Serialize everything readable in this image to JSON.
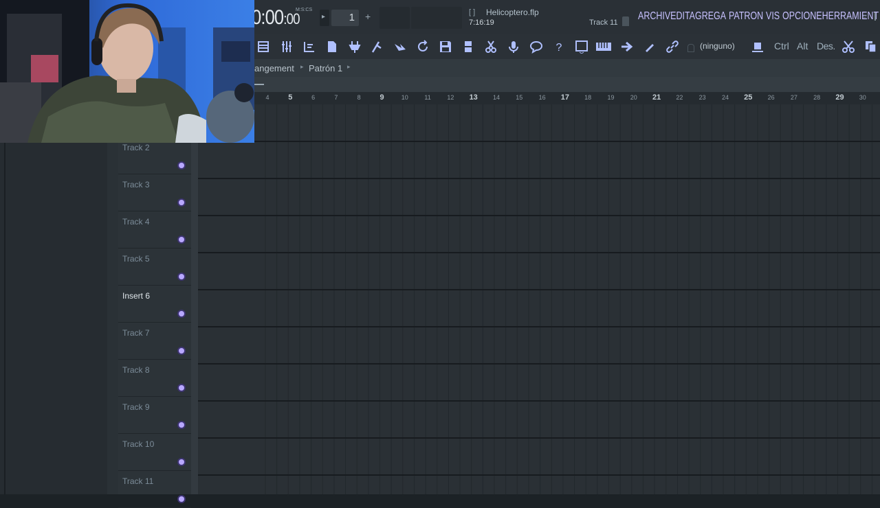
{
  "transport": {
    "time": "0:00",
    "time_small": ":00",
    "time_mode": "M:S:CS",
    "pattern_number": "1",
    "plus": "+",
    "play": "▸"
  },
  "project": {
    "bracket": "[ ]",
    "filename": "Helicoptero.flp",
    "elapsed": "7:16:19",
    "hint_track": "Track 11"
  },
  "menu": {
    "items": [
      "ARCHIV",
      "EDITA",
      "GREGA",
      "PATRON",
      "VIS",
      "OPCIONE",
      "HERRAMIENT",
      "A"
    ]
  },
  "window_controls": {
    "minimize": "–",
    "maximize": "▫"
  },
  "toolbar": {
    "icons": [
      "playlist-icon",
      "mixer-icon",
      "channel-rack-icon",
      "piano-roll-icon",
      "plugin-icon",
      "browser-icon",
      "arrow-icon",
      "refresh-icon",
      "save-icon",
      "render-icon",
      "cut-icon",
      "mic-icon",
      "comment-icon",
      "help-icon",
      "view-icon",
      "keyboard-icon",
      "next-icon",
      "pen-icon",
      "link-icon"
    ],
    "none_label": "(ninguno)",
    "ctrl_label": "Ctrl",
    "alt_label": "Alt",
    "des_label": "Des."
  },
  "breadcrumb": {
    "part1": "angement",
    "sep": "▸",
    "part2": "Patrón 1",
    "sep2": "▸"
  },
  "ruler": {
    "marks": [
      {
        "n": "4",
        "bar": false
      },
      {
        "n": "5",
        "bar": true
      },
      {
        "n": "6",
        "bar": false
      },
      {
        "n": "7",
        "bar": false
      },
      {
        "n": "8",
        "bar": false
      },
      {
        "n": "9",
        "bar": true
      },
      {
        "n": "10",
        "bar": false
      },
      {
        "n": "11",
        "bar": false
      },
      {
        "n": "12",
        "bar": false
      },
      {
        "n": "13",
        "bar": true
      },
      {
        "n": "14",
        "bar": false
      },
      {
        "n": "15",
        "bar": false
      },
      {
        "n": "16",
        "bar": false
      },
      {
        "n": "17",
        "bar": true
      },
      {
        "n": "18",
        "bar": false
      },
      {
        "n": "19",
        "bar": false
      },
      {
        "n": "20",
        "bar": false
      },
      {
        "n": "21",
        "bar": true
      },
      {
        "n": "22",
        "bar": false
      },
      {
        "n": "23",
        "bar": false
      },
      {
        "n": "24",
        "bar": false
      },
      {
        "n": "25",
        "bar": true
      },
      {
        "n": "26",
        "bar": false
      },
      {
        "n": "27",
        "bar": false
      },
      {
        "n": "28",
        "bar": false
      },
      {
        "n": "29",
        "bar": true
      },
      {
        "n": "30",
        "bar": false
      }
    ]
  },
  "tracks": [
    {
      "name": "Track 2",
      "highlight": false
    },
    {
      "name": "Track 3",
      "highlight": false
    },
    {
      "name": "Track 4",
      "highlight": false
    },
    {
      "name": "Track 5",
      "highlight": false
    },
    {
      "name": "Insert 6",
      "highlight": true
    },
    {
      "name": "Track 7",
      "highlight": false
    },
    {
      "name": "Track 8",
      "highlight": false
    },
    {
      "name": "Track 9",
      "highlight": false
    },
    {
      "name": "Track 10",
      "highlight": false
    },
    {
      "name": "Track 11",
      "highlight": false
    }
  ],
  "colors": {
    "accent": "#9b8cff",
    "menu_text": "#c7c1ff",
    "time_text": "#e4e9ee",
    "grid_line": "#20262a"
  }
}
